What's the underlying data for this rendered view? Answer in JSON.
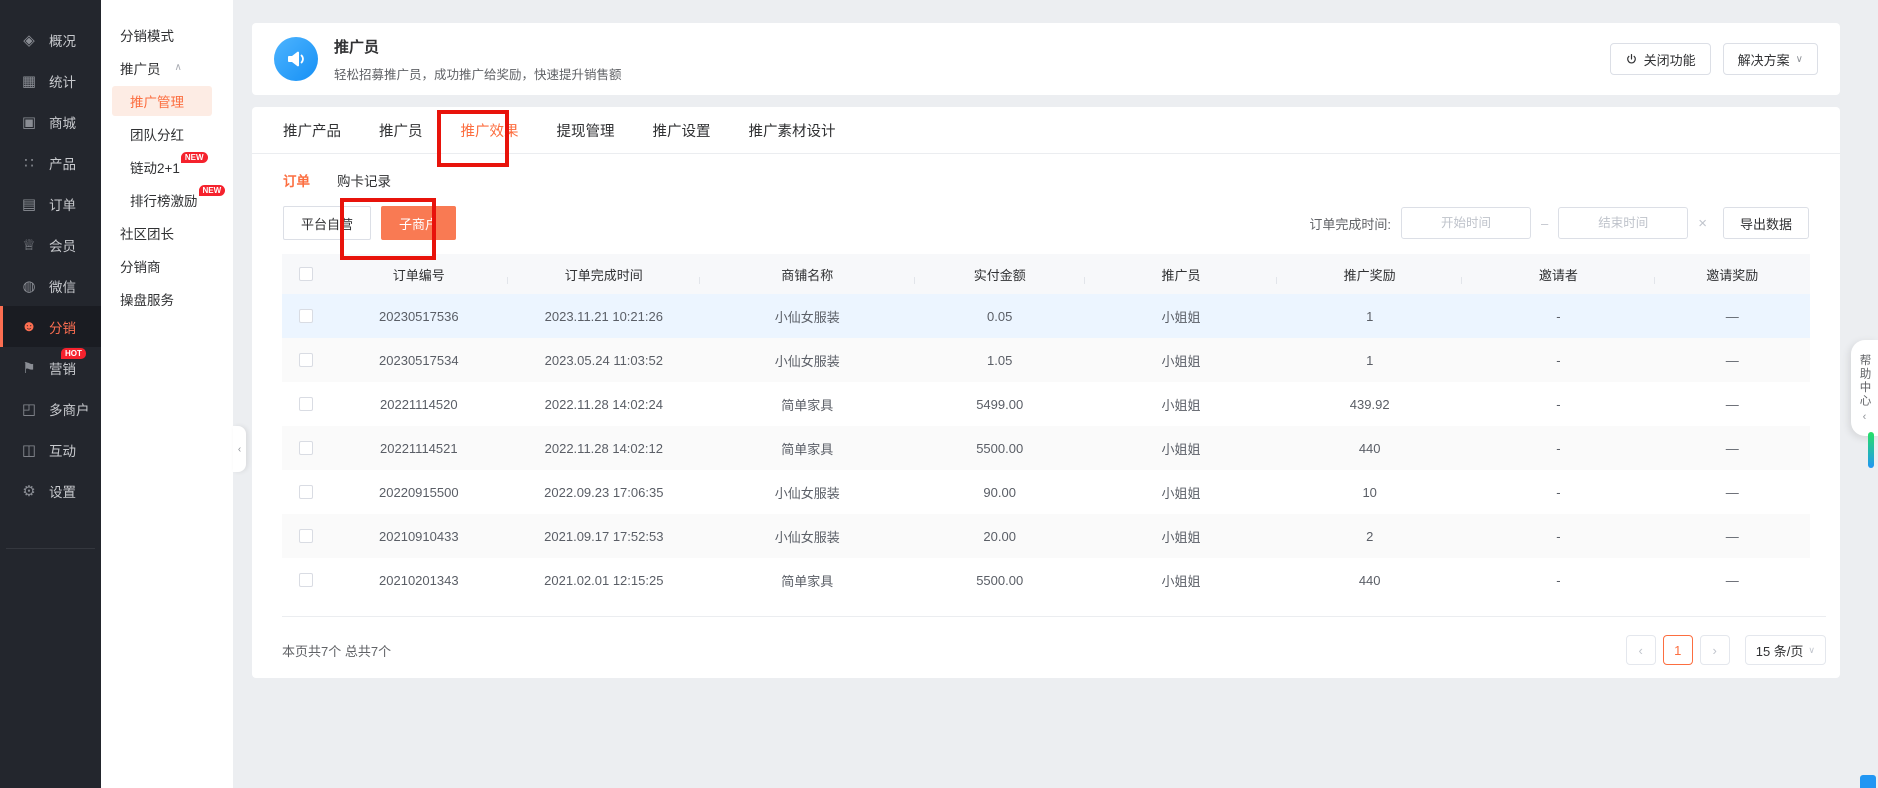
{
  "colors": {
    "accent_orange": "#fc6e40",
    "button_orange": "#f97a53",
    "annotation_red": "#e8130b",
    "badge_red": "#f5222d",
    "icon_blue": "#1690f5",
    "row_highlight_blue": "#ecf5ff"
  },
  "sidebar": {
    "items": [
      {
        "key": "overview",
        "label": "概况",
        "icon": "layers-icon",
        "glyph": "◈"
      },
      {
        "key": "stats",
        "label": "统计",
        "icon": "chart-icon",
        "glyph": "▦"
      },
      {
        "key": "mall",
        "label": "商城",
        "icon": "shop-bag-icon",
        "glyph": "▣"
      },
      {
        "key": "products",
        "label": "产品",
        "icon": "grid-icon",
        "glyph": "∷"
      },
      {
        "key": "orders",
        "label": "订单",
        "icon": "clipboard-icon",
        "glyph": "▤"
      },
      {
        "key": "members",
        "label": "会员",
        "icon": "crown-icon",
        "glyph": "♕"
      },
      {
        "key": "wechat",
        "label": "微信",
        "icon": "chat-bubble-icon",
        "glyph": "◍"
      },
      {
        "key": "distribution",
        "label": "分销",
        "icon": "people-icon",
        "glyph": "☻",
        "active": true
      },
      {
        "key": "marketing",
        "label": "营销",
        "icon": "flag-icon",
        "glyph": "⚑",
        "badge": "HOT"
      },
      {
        "key": "multi-merchant",
        "label": "多商户",
        "icon": "storefront-icon",
        "glyph": "◰"
      },
      {
        "key": "interaction",
        "label": "互动",
        "icon": "users-icon",
        "glyph": "◫"
      },
      {
        "key": "settings",
        "label": "设置",
        "icon": "gear-icon",
        "glyph": "⚙"
      }
    ]
  },
  "submenu": {
    "items": [
      {
        "key": "distribution-mode",
        "label": "分销模式",
        "type": "top"
      },
      {
        "key": "promoter",
        "label": "推广员",
        "type": "top",
        "expanded": true,
        "chevron": "∧"
      },
      {
        "key": "promotion-management",
        "label": "推广管理",
        "type": "child",
        "active": true
      },
      {
        "key": "team-dividend",
        "label": "团队分红",
        "type": "child"
      },
      {
        "key": "chain-2plus1",
        "label": "链动2+1",
        "type": "child",
        "badge": "NEW"
      },
      {
        "key": "ranking-incentive",
        "label": "排行榜激励",
        "type": "child",
        "badge": "NEW"
      },
      {
        "key": "community-leader",
        "label": "社区团长",
        "type": "top"
      },
      {
        "key": "distributor",
        "label": "分销商",
        "type": "top"
      },
      {
        "key": "operation-service",
        "label": "操盘服务",
        "type": "top"
      }
    ]
  },
  "header": {
    "title": "推广员",
    "subtitle": "轻松招募推广员，成功推广给奖励，快速提升销售额",
    "close_button": "关闭功能",
    "solution_button": "解决方案",
    "solution_chevron": "∨"
  },
  "tabs": {
    "items": [
      {
        "key": "promo-products",
        "label": "推广产品"
      },
      {
        "key": "promoters",
        "label": "推广员"
      },
      {
        "key": "promo-effect",
        "label": "推广效果",
        "active": true,
        "annotated": true
      },
      {
        "key": "withdrawal",
        "label": "提现管理"
      },
      {
        "key": "promo-settings",
        "label": "推广设置"
      },
      {
        "key": "promo-material",
        "label": "推广素材设计"
      }
    ]
  },
  "subtabs": {
    "items": [
      {
        "key": "orders",
        "label": "订单",
        "active": true
      },
      {
        "key": "card-purchase",
        "label": "购卡记录"
      }
    ]
  },
  "filters": {
    "merchant_tabs": [
      {
        "key": "platform-self",
        "label": "平台自营"
      },
      {
        "key": "sub-merchant",
        "label": "子商户",
        "active": true,
        "annotated": true
      }
    ],
    "date_label": "订单完成时间:",
    "start_placeholder": "开始时间",
    "separator": "–",
    "end_placeholder": "结束时间",
    "clear_icon": "×",
    "export_button": "导出数据"
  },
  "table": {
    "columns": [
      "订单编号",
      "订单完成时间",
      "商铺名称",
      "实付金额",
      "推广员",
      "推广奖励",
      "邀请者",
      "邀请奖励"
    ],
    "rows": [
      [
        "20230517536",
        "2023.11.21 10:21:26",
        "小仙女服装",
        "0.05",
        "小姐姐",
        "1",
        "-",
        "—"
      ],
      [
        "20230517534",
        "2023.05.24 11:03:52",
        "小仙女服装",
        "1.05",
        "小姐姐",
        "1",
        "-",
        "—"
      ],
      [
        "20221114520",
        "2022.11.28 14:02:24",
        "简单家具",
        "5499.00",
        "小姐姐",
        "439.92",
        "-",
        "—"
      ],
      [
        "20221114521",
        "2022.11.28 14:02:12",
        "简单家具",
        "5500.00",
        "小姐姐",
        "440",
        "-",
        "—"
      ],
      [
        "20220915500",
        "2022.09.23 17:06:35",
        "小仙女服装",
        "90.00",
        "小姐姐",
        "10",
        "-",
        "—"
      ],
      [
        "20210910433",
        "2021.09.17 17:52:53",
        "小仙女服装",
        "20.00",
        "小姐姐",
        "2",
        "-",
        "—"
      ],
      [
        "20210201343",
        "2021.02.01 12:15:25",
        "简单家具",
        "5500.00",
        "小姐姐",
        "440",
        "-",
        "—"
      ]
    ]
  },
  "pagination": {
    "summary": "本页共7个 总共7个",
    "prev": "‹",
    "page": "1",
    "next": "›",
    "per_page": "15 条/页",
    "per_page_chevron": "∨"
  },
  "help": {
    "label": "帮助中心",
    "collapse_chevron": "‹"
  },
  "side_collapse_chevron": "‹"
}
